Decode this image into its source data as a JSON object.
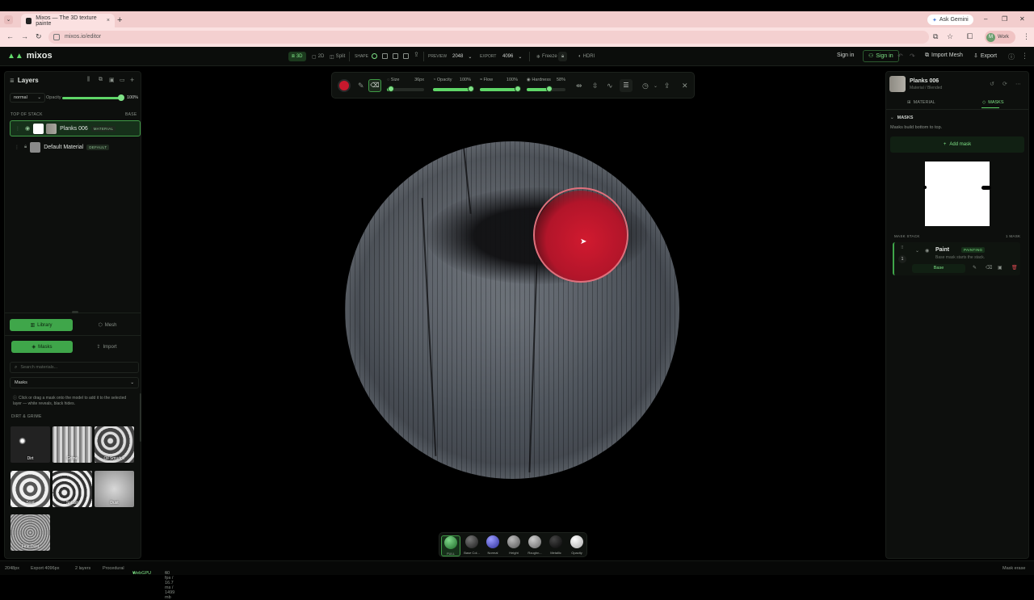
{
  "browser": {
    "tab_title": "Mixos — The 3D texture painte",
    "ask_gemini": "Ask Gemini",
    "url": "mixos.io/editor",
    "profile": "Work",
    "profile_initial": "M"
  },
  "header": {
    "logo": "mixos",
    "view_3d": "3D",
    "view_2d": "2D",
    "view_split": "Split",
    "shape_label": "SHAPE",
    "preview_label": "PREVIEW",
    "preview_value": "2048",
    "export_label": "EXPORT",
    "export_value": "4096",
    "freeze": "Freeze",
    "hdri": "HDRI",
    "sign_in": "Sign in",
    "sign_in_accent": "Sign in",
    "import_mesh": "Import Mesh",
    "export": "Export"
  },
  "layers": {
    "title": "Layers",
    "blend_mode": "normal",
    "opacity_label": "Opacity",
    "opacity_value": "100%",
    "top_of_stack": "TOP OF STACK",
    "base": "BASE",
    "items": [
      {
        "name": "Planks 006",
        "badge": "MATERIAL"
      },
      {
        "name": "Default Material",
        "badge": "DEFAULT"
      }
    ]
  },
  "library": {
    "tab_library": "Library",
    "tab_mesh": "Mesh",
    "btn_masks": "Masks",
    "btn_import": "Import",
    "search_placeholder": "Search materials...",
    "category": "Masks",
    "hint": "Click or drag a mask onto the model to add it to the selected layer — white reveals, black hides.",
    "section": "DIRT & GRIME",
    "tiles": [
      "Dirt",
      "Grime",
      "Oil Smudge",
      "Soot",
      "Splash",
      "Dust",
      "Fine Dust"
    ]
  },
  "brush": {
    "size_label": "Size",
    "size_value": "36px",
    "size_level": 0.1,
    "opacity_label": "Opacity",
    "opacity_value": "100%",
    "opacity_level": 1.0,
    "flow_label": "Flow",
    "flow_value": "100%",
    "flow_level": 1.0,
    "hardness_label": "Hardness",
    "hardness_value": "58%",
    "hardness_level": 0.58
  },
  "channels": [
    "FULL",
    "Base Col...",
    "Normal",
    "Height",
    "Roughn...",
    "Metallic",
    "Opacity"
  ],
  "colors": {
    "accent": "#5fd668",
    "paint": "#c8192d"
  },
  "right": {
    "material_name": "Planks 006",
    "material_path": "Material / Blended",
    "tab_material": "MATERIAL",
    "tab_masks": "MASKS",
    "masks_title": "MASKS",
    "masks_hint": "Masks build bottom to top.",
    "add_mask": "Add mask",
    "mask_stack": "MASK STACK",
    "mask_count": "1 MASK",
    "mask": {
      "name": "Paint",
      "badge": "PAINTING",
      "desc": "Base mask starts the stack.",
      "base_btn": "Base",
      "index": "1"
    }
  },
  "status": {
    "res": "2048px",
    "export": "Export 4096px",
    "layers": "2 layers",
    "mode": "Procedural",
    "gpu": "WebGPU",
    "perf": "60 fps / 16.7 ms / 1499 mb",
    "tool": "Mask erase"
  }
}
